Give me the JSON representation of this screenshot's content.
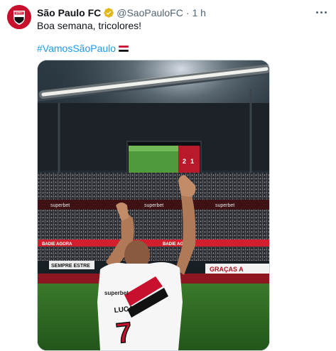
{
  "tweet": {
    "author_name": "São Paulo FC",
    "handle": "@SaoPauloFC",
    "separator": "·",
    "time": "1 h",
    "text": "Boa semana, tricolores!",
    "hashtag": "#VamosSãoPaulo",
    "flag_icon": "flag-sao-paulo-icon",
    "avatar_text": "SPFC"
  },
  "photo": {
    "scoreboard_home": "2",
    "scoreboard_away": "1",
    "jersey_name": "LUCAS",
    "jersey_number": "7",
    "sponsor": "superbet",
    "stand_banner": "GRAÇAS A",
    "stand_banner_left": "SEMPRE ESTRE",
    "ad_board": "BADIE AGORA",
    "ad_board_upper": "superbet"
  },
  "colors": {
    "brand_red": "#c8102e",
    "link_blue": "#1d9bf0",
    "verified_gold": "#e2b719",
    "text_primary": "#0f1419",
    "text_secondary": "#536471"
  }
}
